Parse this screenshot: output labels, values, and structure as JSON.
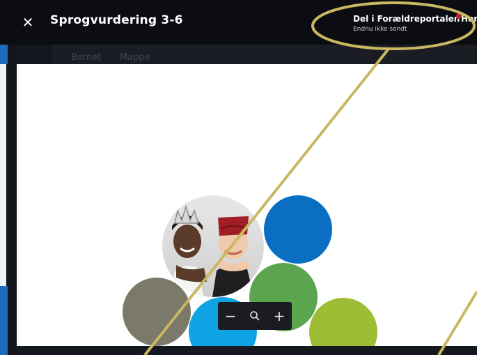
{
  "header": {
    "close_symbol": "✕",
    "title": "Sprogvurdering 3-6",
    "share_label": "Del i Forældreportalen",
    "share_status": "Endnu ikke sendt",
    "right_label": "Hen"
  },
  "tabs": [
    {
      "label": "Barnet"
    },
    {
      "label": "Mappe"
    }
  ],
  "zoom": {
    "minus": "−",
    "plus": "+"
  },
  "colors": {
    "topbar": "#0b0d12",
    "circle_blue_dark": "#0a6fc2",
    "circle_green": "#5aa54d",
    "circle_gray": "#7a796a",
    "circle_blue_light": "#0fa3e3",
    "circle_lime": "#9cbd34",
    "annotation": "#c9b862"
  }
}
